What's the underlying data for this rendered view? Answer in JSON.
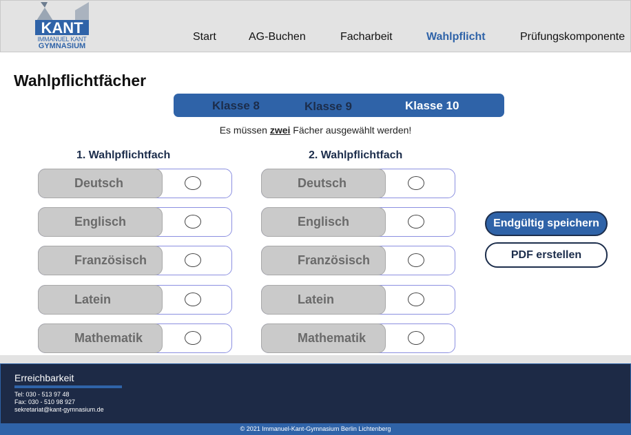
{
  "header": {
    "logo": {
      "line1": "IMMANUEL KANT",
      "line2": "GYMNASIUM",
      "mark": "KANT"
    },
    "nav": [
      "Start",
      "AG-Buchen",
      "Facharbeit",
      "Wahlpflicht",
      "Prüfungskomponente"
    ],
    "active_nav": "Wahlpflicht"
  },
  "page_title": "Wahlpflichtfächer",
  "tabs": [
    "Klasse 8",
    "Klasse 9",
    "Klasse 10"
  ],
  "active_tab": "Klasse 10",
  "hint": {
    "before": "Es müssen ",
    "emph": "zwei",
    "after": " Fächer ausgewählt werden!"
  },
  "columns": [
    {
      "title": "1. Wahlpflichtfach",
      "options": [
        "Deutsch",
        "Englisch",
        "Französisch",
        "Latein",
        "Mathematik"
      ]
    },
    {
      "title": "2. Wahlpflichtfach",
      "options": [
        "Deutsch",
        "Englisch",
        "Französisch",
        "Latein",
        "Mathematik"
      ]
    }
  ],
  "buttons": {
    "save": "Endgültig speichern",
    "pdf": "PDF erstellen"
  },
  "footer": {
    "title": "Erreichbarkeit",
    "tel": "Tel:  030 - 513 97 48",
    "fax": "Fax: 030 - 510 98 927",
    "email": "sekretariat@kant-gymnasium.de",
    "copyright": "© 2021 Immanuel-Kant-Gymnasium Berlin Lichtenberg"
  },
  "colors": {
    "primary": "#2f63a8",
    "dark": "#1d2a46",
    "header_bg": "#e3e3e3",
    "option_bg": "#cacaca"
  }
}
